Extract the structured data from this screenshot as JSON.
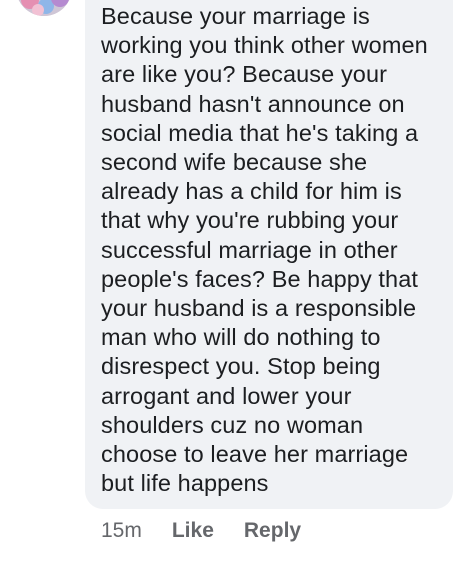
{
  "comment": {
    "lines": [
      "Because your marriage is",
      "working you think other women",
      "are like you? Because your",
      "husband hasn't announce on",
      "social media that he's taking a",
      "second wife because she",
      "already has a child for him is",
      "that why you're rubbing your",
      "successful marriage in other",
      "people's faces? Be happy that",
      "your husband is a responsible",
      "man who will do nothing to",
      "disrespect you. Stop being",
      "arrogant and lower your",
      "shoulders cuz no woman",
      "choose to leave her marriage",
      "but life happens"
    ]
  },
  "meta": {
    "time": "15m",
    "like_label": "Like",
    "reply_label": "Reply"
  },
  "colors": {
    "bubble_background": "#f0f2f5",
    "text": "#1c1e21",
    "meta_text": "#65676b"
  }
}
